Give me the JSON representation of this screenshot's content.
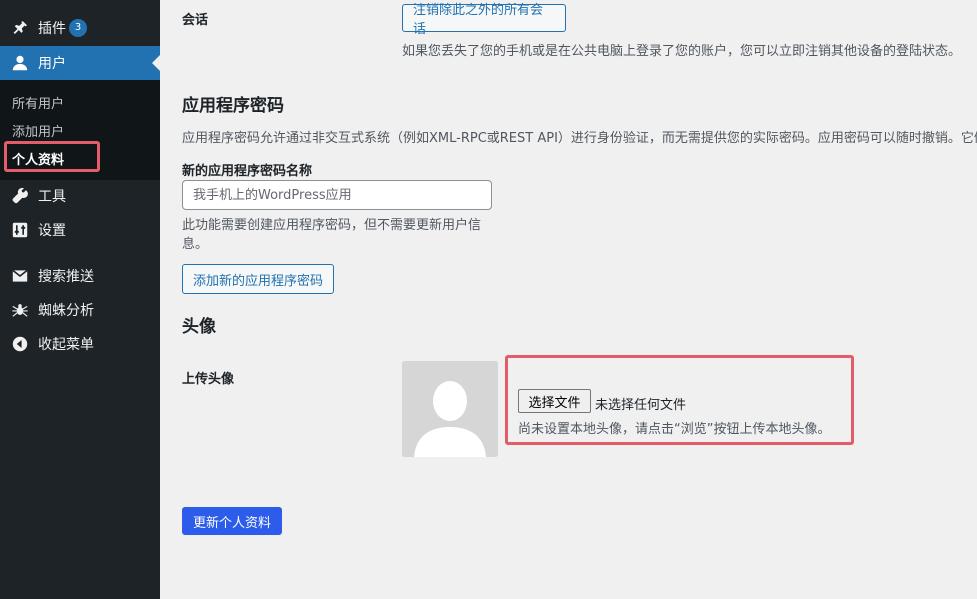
{
  "sidebar": {
    "plugins": {
      "label": "插件",
      "badge": "3",
      "icon": "plugin-icon"
    },
    "users": {
      "label": "用户",
      "icon": "user-icon"
    },
    "submenu": [
      {
        "label": "所有用户"
      },
      {
        "label": "添加用户"
      },
      {
        "label": "个人资料"
      }
    ],
    "tools": {
      "label": "工具",
      "icon": "wrench-icon"
    },
    "settings": {
      "label": "设置",
      "icon": "settings-icon"
    },
    "seo_push": {
      "label": "搜索推送",
      "icon": "push-icon"
    },
    "spider": {
      "label": "蜘蛛分析",
      "icon": "spider-icon"
    },
    "collapse": {
      "label": "收起菜单",
      "icon": "collapse-icon"
    }
  },
  "sessions": {
    "label": "会话",
    "button": "注销除此之外的所有会话",
    "description": "如果您丢失了您的手机或是在公共电脑上登录了您的账户，您可以立即注销其他设备的登陆状态。"
  },
  "app_passwords": {
    "title": "应用程序密码",
    "description": "应用程序密码允许通过非交互式系统（例如XML-RPC或REST API）进行身份验证，而无需提供您的实际密码。应用密码可以随时撤销。它们不能用于通过传统方式登录您的网站。",
    "name_label": "新的应用程序密码名称",
    "name_placeholder": "我手机上的WordPress应用",
    "hint_line1": "此功能需要创建应用程序密码，但不需要更新用户信",
    "hint_line2": "息。",
    "add_button": "添加新的应用程序密码"
  },
  "avatar": {
    "title": "头像",
    "upload_label": "上传头像",
    "choose_file": "选择文件",
    "no_file": "未选择任何文件",
    "hint": "尚未设置本地头像，请点击“浏览”按钮上传本地头像。"
  },
  "update_button": "更新个人资料",
  "colors": {
    "sidebar_bg": "#1d2327",
    "accent": "#2271b1",
    "primary_button": "#2c5ce9",
    "highlight": "#e45c6a"
  }
}
